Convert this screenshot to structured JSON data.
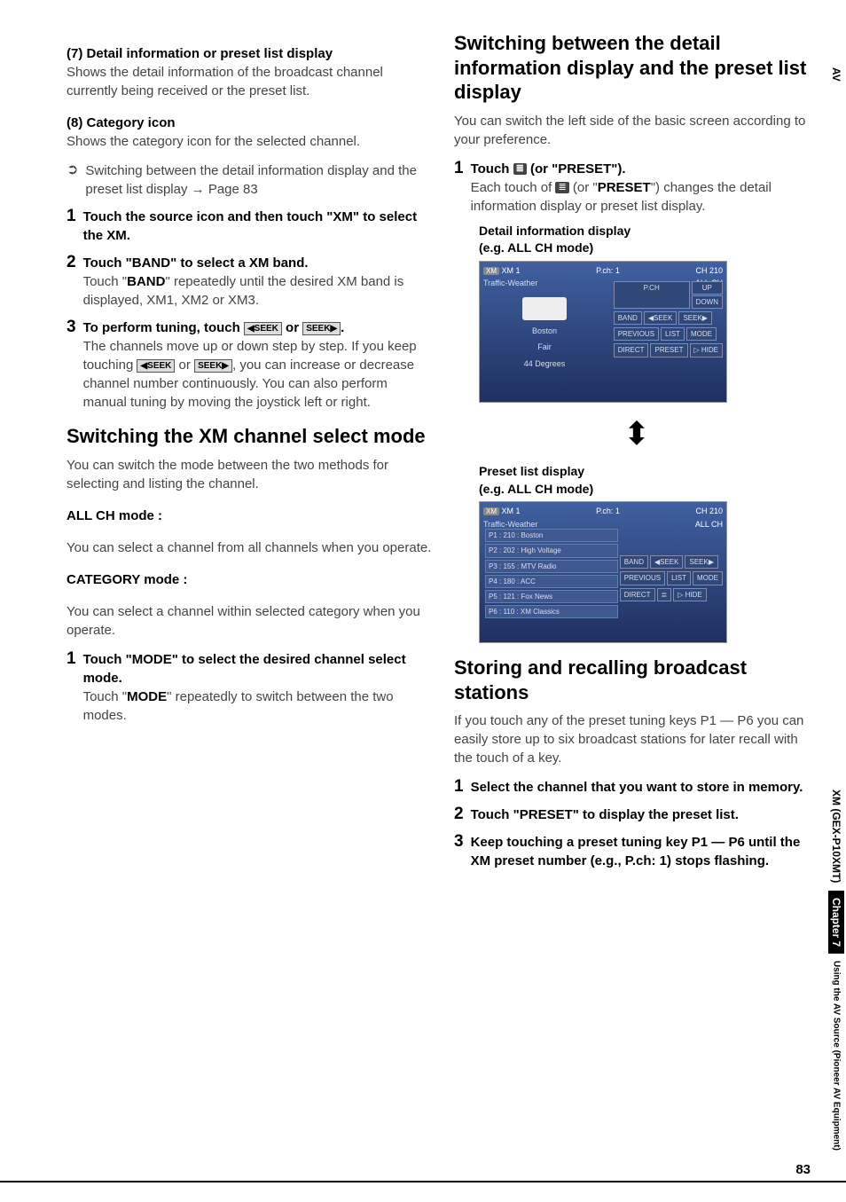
{
  "left": {
    "item7_title": "(7) Detail information or preset list display",
    "item7_body": "Shows the detail information of the broadcast channel currently being received or the preset list.",
    "item8_title": "(8) Category icon",
    "item8_body": "Shows the category icon for the selected channel.",
    "xref_icon": "➲",
    "xref_text": "Switching between the detail information display and the preset list display",
    "xref_arrow": "→",
    "xref_page": "Page 83",
    "step1_head": "Touch the source icon and then touch \"XM\" to select the XM.",
    "step2_head": "Touch \"BAND\" to select a XM band.",
    "step2_body_a": "Touch \"",
    "step2_body_b": "BAND",
    "step2_body_c": "\" repeatedly until the desired XM band is displayed, XM1, XM2 or XM3.",
    "step3_head_a": "To perform tuning, touch ",
    "step3_head_b": " or ",
    "step3_head_c": ".",
    "seek_left": "◀SEEK",
    "seek_right": "SEEK▶",
    "step3_body_a": "The channels move up or down step by step. If you keep touching ",
    "step3_body_b": " or ",
    "step3_body_c": ", you can increase or decrease channel number continuously. You can also perform manual tuning by moving the joystick left or right.",
    "h_switchmode": "Switching the XM channel select mode",
    "switchmode_intro": "You can switch the mode between the two methods for selecting and listing the channel.",
    "allch_label": "ALL CH mode :",
    "allch_body": "You can select a channel from all channels when you operate.",
    "cat_label": "CATEGORY mode :",
    "cat_body": "You can select a channel within selected category when you operate.",
    "modestep_head": "Touch \"MODE\" to select the desired channel select mode.",
    "modestep_body_a": "Touch \"",
    "modestep_body_b": "MODE",
    "modestep_body_c": "\" repeatedly to switch between the two modes."
  },
  "right": {
    "h_switchdisplay": "Switching between the detail information display and the preset list display",
    "switchdisplay_intro": "You can switch the left side of the basic screen according to your preference.",
    "touch_step_a": "Touch ",
    "touch_step_icon": "≣",
    "touch_step_b": " (or \"PRESET\").",
    "touch_body_a": "Each touch of ",
    "touch_body_b": " (or \"",
    "touch_body_preset": "PRESET",
    "touch_body_c": "\") changes the detail information display or preset list display.",
    "note_detail": "Detail information display\n (e.g. ALL CH mode)",
    "note_preset": "Preset list display\n(e.g. ALL CH mode)",
    "arrow": "⬍",
    "h_storing": "Storing and recalling broadcast stations",
    "storing_intro": "If you touch any of the preset tuning keys P1 — P6 you can easily store up to six broadcast stations for later recall with the touch of a key.",
    "store_step1": "Select the channel that you want to store in memory.",
    "store_step2": "Touch \"PRESET\" to display the preset list.",
    "store_step3": "Keep touching a preset tuning key P1 — P6 until the XM preset number (e.g., P.ch: 1) stops flashing."
  },
  "screenshot1": {
    "logo": "XM",
    "line1a": "XM 1",
    "line1b": "P.ch: 1",
    "line1c": "CH 210",
    "line2": "Traffic-Weather",
    "allch": "ALL CH",
    "city": "Boston",
    "cond": "Fair",
    "temp": "44 Degrees",
    "btn_pch": "P.CH",
    "btn_up": "UP",
    "btn_down": "DOWN",
    "btn_band": "BAND",
    "btn_seekl": "◀SEEK",
    "btn_seekr": "SEEK▶",
    "btn_prev": "PREVIOUS",
    "btn_list": "LIST",
    "btn_mode": "MODE",
    "btn_direct": "DIRECT",
    "btn_preset": "PRESET",
    "btn_hide": "▷ HIDE"
  },
  "screenshot2": {
    "logo": "XM",
    "line1a": "XM 1",
    "line1b": "P.ch: 1",
    "line1c": "CH 210",
    "line2": "Traffic-Weather",
    "allch": "ALL CH",
    "p1": "P1 : 210 : Boston",
    "p2": "P2 : 202 : High Voltage",
    "p3": "P3 : 155 : MTV Radio",
    "p4": "P4 : 180 : ACC",
    "p5": "P5 : 121 : Fox News",
    "p6": "P6 : 110 : XM Classics",
    "btn_band": "BAND",
    "btn_seekl": "◀SEEK",
    "btn_seekr": "SEEK▶",
    "btn_prev": "PREVIOUS",
    "btn_list": "LIST",
    "btn_mode": "MODE",
    "btn_direct": "DIRECT",
    "btn_preseticon": "≣",
    "btn_hide": "▷ HIDE"
  },
  "side": {
    "av": "AV",
    "model": "XM (GEX-P10XMT)",
    "chapter": "Chapter 7",
    "using": "Using the AV Source (Pioneer AV Equipment)"
  },
  "pagenum": "83",
  "nums": {
    "n1": "1",
    "n2": "2",
    "n3": "3"
  }
}
